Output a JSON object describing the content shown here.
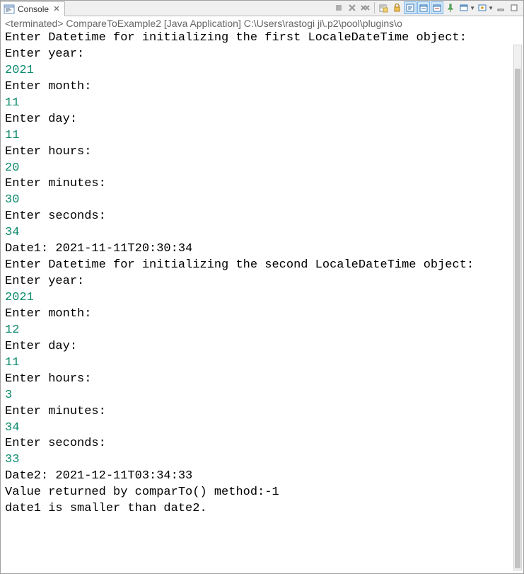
{
  "tab": {
    "label": "Console"
  },
  "term_line": "<terminated> CompareToExample2 [Java Application] C:\\Users\\rastogi ji\\.p2\\pool\\plugins\\o",
  "lines": [
    {
      "t": "out",
      "v": "Enter Datetime for initializing the first LocaleDateTime object:"
    },
    {
      "t": "out",
      "v": "Enter year:"
    },
    {
      "t": "in",
      "v": "2021"
    },
    {
      "t": "out",
      "v": "Enter month:"
    },
    {
      "t": "in",
      "v": "11"
    },
    {
      "t": "out",
      "v": "Enter day:"
    },
    {
      "t": "in",
      "v": "11"
    },
    {
      "t": "out",
      "v": "Enter hours:"
    },
    {
      "t": "in",
      "v": "20"
    },
    {
      "t": "out",
      "v": "Enter minutes:"
    },
    {
      "t": "in",
      "v": "30"
    },
    {
      "t": "out",
      "v": "Enter seconds:"
    },
    {
      "t": "in",
      "v": "34"
    },
    {
      "t": "out",
      "v": "Date1: 2021-11-11T20:30:34"
    },
    {
      "t": "out",
      "v": "Enter Datetime for initializing the second LocaleDateTime object:"
    },
    {
      "t": "out",
      "v": "Enter year:"
    },
    {
      "t": "in",
      "v": "2021"
    },
    {
      "t": "out",
      "v": "Enter month:"
    },
    {
      "t": "in",
      "v": "12"
    },
    {
      "t": "out",
      "v": "Enter day:"
    },
    {
      "t": "in",
      "v": "11"
    },
    {
      "t": "out",
      "v": "Enter hours:"
    },
    {
      "t": "in",
      "v": "3"
    },
    {
      "t": "out",
      "v": "Enter minutes:"
    },
    {
      "t": "in",
      "v": "34"
    },
    {
      "t": "out",
      "v": "Enter seconds:"
    },
    {
      "t": "in",
      "v": "33"
    },
    {
      "t": "out",
      "v": "Date2: 2021-12-11T03:34:33"
    },
    {
      "t": "out",
      "v": "Value returned by comparTo() method:-1"
    },
    {
      "t": "out",
      "v": "date1 is smaller than date2."
    }
  ]
}
